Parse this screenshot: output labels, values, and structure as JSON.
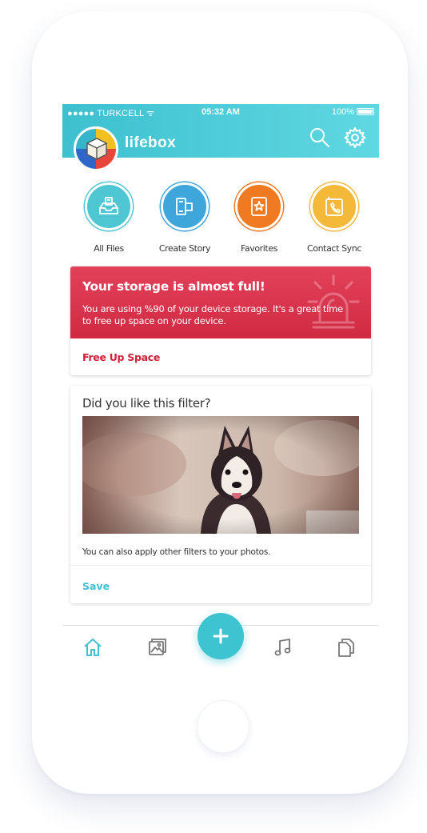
{
  "status_bar": {
    "carrier": "●●●●● TURKCELL ᯤ",
    "time": "05:32 AM",
    "battery": "100%"
  },
  "header": {
    "brand": "lifebox",
    "icons": [
      "search-icon",
      "gear-icon"
    ]
  },
  "quick_actions": [
    {
      "label": "All Files",
      "color": "#4ec7d3",
      "icon": "inbox-icon"
    },
    {
      "label": "Create Story",
      "color": "#3fa6dc",
      "icon": "film-icon"
    },
    {
      "label": "Favorites",
      "color": "#f07a22",
      "icon": "star-bookmark-icon"
    },
    {
      "label": "Contact Sync",
      "color": "#f5b93a",
      "icon": "contact-phone-icon"
    }
  ],
  "storage_card": {
    "title": "Your storage is almost full!",
    "message": "You are using %90 of your device storage. It's a great time to free up space on your device.",
    "action": "Free Up Space",
    "accent": "#d92e47"
  },
  "filter_card": {
    "title": "Did you like this filter?",
    "caption": "You can also apply other filters to your photos.",
    "action": "Save"
  },
  "tabbar": {
    "tabs": [
      "home-icon",
      "photos-icon",
      "music-icon",
      "documents-icon"
    ],
    "fab": "+"
  },
  "colors": {
    "brand": "#41c0cf",
    "alert": "#d92e47"
  }
}
